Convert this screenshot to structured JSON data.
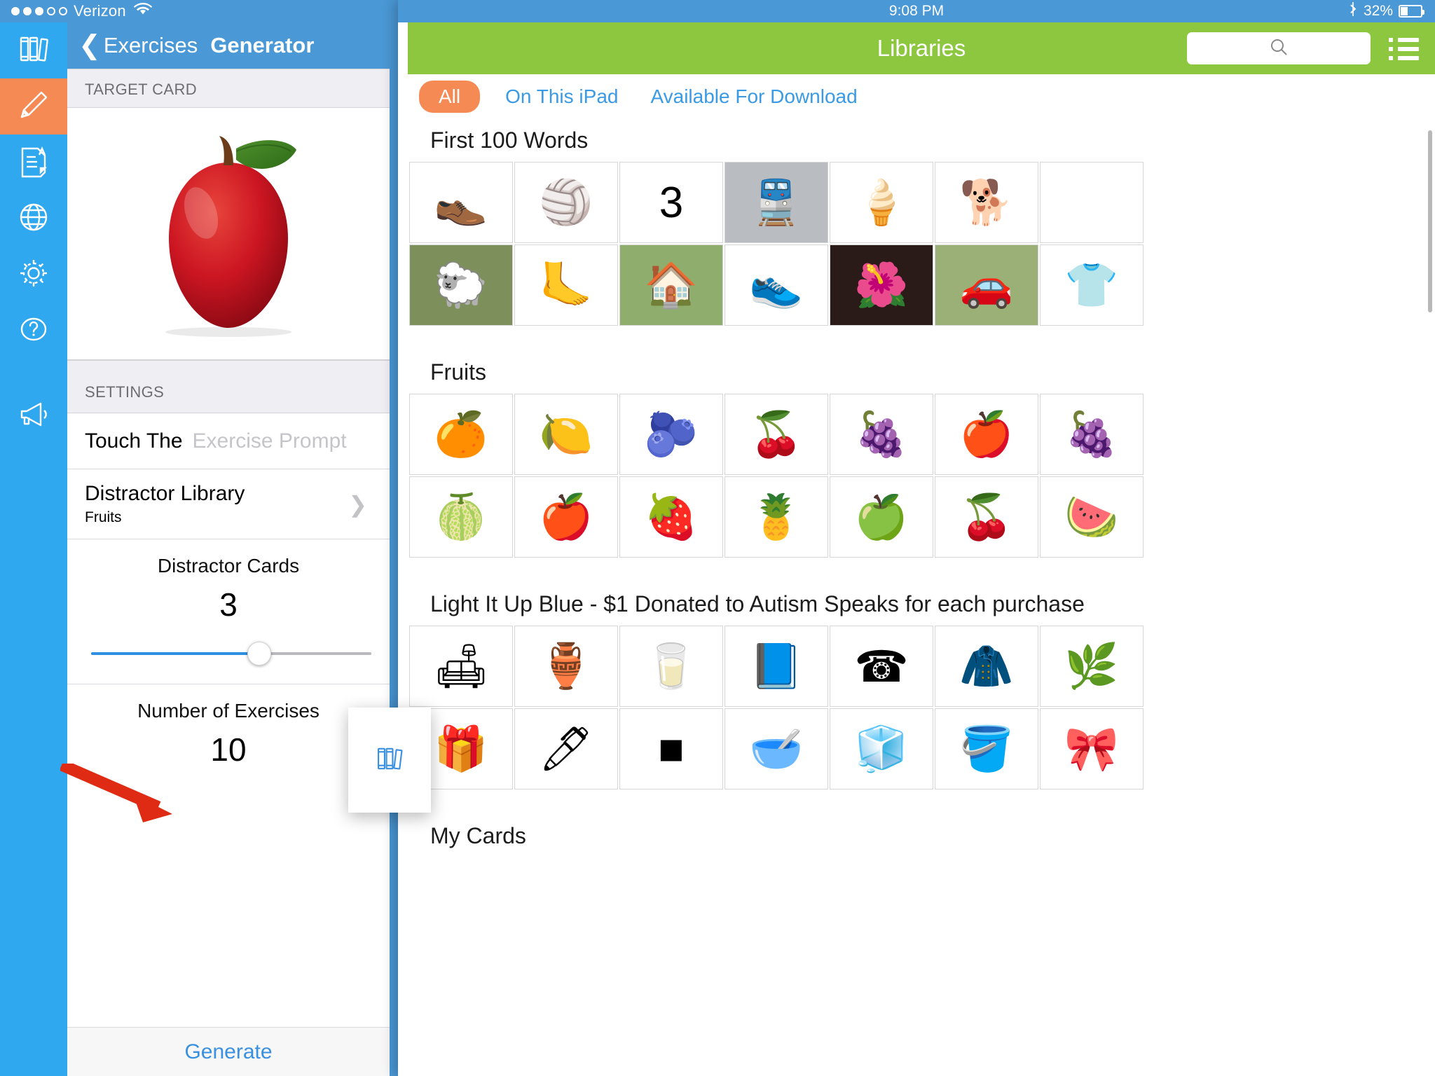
{
  "left_app": {
    "status_bar": {
      "signal_dots_filled": 3,
      "signal_dots_total": 5,
      "carrier": "Verizon",
      "wifi_icon": "wifi-icon"
    },
    "nav": {
      "items": [
        {
          "icon": "books-icon",
          "name": "libraries",
          "active": false
        },
        {
          "icon": "pencil-icon",
          "name": "exercises",
          "active": true
        },
        {
          "icon": "document-a-icon",
          "name": "reports",
          "active": false
        },
        {
          "icon": "globe-icon",
          "name": "web",
          "active": false
        },
        {
          "icon": "gear-icon",
          "name": "settings",
          "active": false
        },
        {
          "icon": "question-mark-icon",
          "name": "help",
          "active": false
        },
        {
          "icon": "megaphone-icon",
          "name": "announcements",
          "active": false
        }
      ]
    },
    "header": {
      "back_icon": "chevron-left-icon",
      "back_label": "Exercises",
      "title": "Generator"
    },
    "target_card": {
      "section_label": "TARGET CARD",
      "image_alt": "red apple"
    },
    "settings": {
      "section_label": "SETTINGS",
      "prompt_row": {
        "label": "Touch The",
        "placeholder": "Exercise Prompt",
        "value": ""
      },
      "distractor_library": {
        "label": "Distractor Library",
        "value": "Fruits",
        "disclosure_icon": "chevron-right-icon"
      },
      "distractor_cards": {
        "label": "Distractor Cards",
        "value": "3",
        "slider_percent": 60
      },
      "number_of_exercises": {
        "label": "Number of Exercises",
        "value": "10"
      }
    },
    "generate_button": {
      "label": "Generate"
    },
    "annotation": {
      "arrow_color": "#e02b14",
      "points_to": "Generate"
    },
    "drag_card": {
      "icon": "books-icon"
    }
  },
  "right_app": {
    "status_bar": {
      "time": "9:08 PM",
      "bluetooth_icon": "bluetooth-icon",
      "battery_percent": "32%",
      "battery_icon": "battery-icon"
    },
    "header": {
      "title": "Libraries",
      "search_icon": "search-icon",
      "search_placeholder": "",
      "menu_icon": "hamburger-icon"
    },
    "filters": [
      {
        "label": "All",
        "selected": true
      },
      {
        "label": "On This iPad",
        "selected": false
      },
      {
        "label": "Available For Download",
        "selected": false
      }
    ],
    "sections": [
      {
        "title": "First 100 Words",
        "rows": [
          [
            {
              "glyph": "👞",
              "alt": "slippers",
              "bg": "#ffffff"
            },
            {
              "glyph": "🏐",
              "alt": "beach ball",
              "bg": "#ffffff"
            },
            {
              "glyph": "3",
              "alt": "number three",
              "bg": "#ffffff"
            },
            {
              "glyph": "🚆",
              "alt": "trains",
              "bg": "#b9bcc0"
            },
            {
              "glyph": "🍦",
              "alt": "ice cream cone",
              "bg": "#ffffff"
            },
            {
              "glyph": "🐕",
              "alt": "dog",
              "bg": "#ffffff"
            },
            {
              "glyph": "",
              "alt": "partially visible card",
              "bg": "#ffffff"
            }
          ],
          [
            {
              "glyph": "🐑",
              "alt": "sheep",
              "bg": "#7d8f5a"
            },
            {
              "glyph": "🦶",
              "alt": "feet",
              "bg": "#ffffff"
            },
            {
              "glyph": "🏠",
              "alt": "house",
              "bg": "#8fae6d"
            },
            {
              "glyph": "👟",
              "alt": "white shoes",
              "bg": "#ffffff"
            },
            {
              "glyph": "🌺",
              "alt": "flower",
              "bg": "#2a1a18"
            },
            {
              "glyph": "🚗",
              "alt": "red car",
              "bg": "#9bb077"
            },
            {
              "glyph": "👕",
              "alt": "t-shirt",
              "bg": "#ffffff"
            }
          ]
        ]
      },
      {
        "title": "Fruits",
        "rows": [
          [
            {
              "glyph": "🍊",
              "alt": "grapefruit",
              "bg": "#ffffff"
            },
            {
              "glyph": "🍋",
              "alt": "lemon",
              "bg": "#ffffff"
            },
            {
              "glyph": "🫐",
              "alt": "blueberries",
              "bg": "#ffffff"
            },
            {
              "glyph": "🍒",
              "alt": "cherries",
              "bg": "#ffffff"
            },
            {
              "glyph": "🍇",
              "alt": "raspberries",
              "bg": "#ffffff"
            },
            {
              "glyph": "🍎",
              "alt": "apple",
              "bg": "#ffffff"
            },
            {
              "glyph": "🍇",
              "alt": "grapes",
              "bg": "#ffffff"
            }
          ],
          [
            {
              "glyph": "🍈",
              "alt": "cantaloupe",
              "bg": "#ffffff"
            },
            {
              "glyph": "🍎",
              "alt": "red apple",
              "bg": "#ffffff"
            },
            {
              "glyph": "🍓",
              "alt": "strawberries basket",
              "bg": "#ffffff"
            },
            {
              "glyph": "🍍",
              "alt": "pineapple",
              "bg": "#ffffff"
            },
            {
              "glyph": "🍏",
              "alt": "limes",
              "bg": "#ffffff"
            },
            {
              "glyph": "🍒",
              "alt": "bowl of cherries",
              "bg": "#ffffff"
            },
            {
              "glyph": "🍉",
              "alt": "melon slice",
              "bg": "#ffffff"
            }
          ]
        ]
      },
      {
        "title": "Light It Up Blue - $1 Donated to Autism Speaks for each purchase",
        "rows": [
          [
            {
              "glyph": "🛋",
              "alt": "blue armchair",
              "bg": "#ffffff"
            },
            {
              "glyph": "🏺",
              "alt": "blue vase",
              "bg": "#ffffff"
            },
            {
              "glyph": "🥛",
              "alt": "blue glasses",
              "bg": "#ffffff"
            },
            {
              "glyph": "📘",
              "alt": "blue book",
              "bg": "#ffffff"
            },
            {
              "glyph": "☎",
              "alt": "blue telephone",
              "bg": "#ffffff"
            },
            {
              "glyph": "🧥",
              "alt": "blue hanger",
              "bg": "#ffffff"
            },
            {
              "glyph": "🌿",
              "alt": "blue plant",
              "bg": "#ffffff"
            }
          ],
          [
            {
              "glyph": "🎁",
              "alt": "blue gift",
              "bg": "#ffffff"
            },
            {
              "glyph": "🖊",
              "alt": "blue pen",
              "bg": "#ffffff"
            },
            {
              "glyph": "■",
              "alt": "blue square",
              "bg": "#ffffff"
            },
            {
              "glyph": "🥣",
              "alt": "blue bowls",
              "bg": "#ffffff"
            },
            {
              "glyph": "🧊",
              "alt": "blue glass cubes",
              "bg": "#ffffff"
            },
            {
              "glyph": "🪣",
              "alt": "blue bucket",
              "bg": "#ffffff"
            },
            {
              "glyph": "🎀",
              "alt": "blue bow",
              "bg": "#ffffff"
            }
          ]
        ]
      },
      {
        "title": "My Cards",
        "rows": []
      }
    ]
  },
  "colors": {
    "ios_blue": "#2fa8ef",
    "nav_blue": "#4a98d6",
    "accent_orange": "#f58a54",
    "green_bar": "#8dc63f",
    "link_blue": "#3a9ae3",
    "arrow_red": "#e02b14"
  }
}
